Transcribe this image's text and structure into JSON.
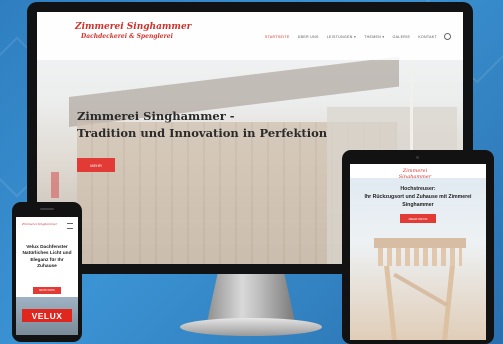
{
  "desktop": {
    "logo_line1": "Zimmerei Singhammer",
    "logo_line2": "Dachdeckerei & Spenglerei",
    "menu": [
      "STARTSEITE",
      "ÜBER UNS",
      "LEISTUNGEN ▾",
      "THEMEN ▾",
      "GALERIE",
      "KONTAKT"
    ],
    "hero_title_line1": "Zimmerei Singhammer -",
    "hero_title_line2": "Tradition und Innovation in Perfektion",
    "hero_button": "MEHR"
  },
  "tablet": {
    "logo": "Zimmerei Singhammer",
    "headline_line1": "Hochstreuser:",
    "headline_line2": "Ihr Rückzugsort und Zuhause mit Zimmerei",
    "headline_line3": "Singhammer",
    "button": "MEHR INFOS"
  },
  "phone": {
    "logo": "Zimmerei Singhammer",
    "headline": "Velux Dachfenster Natürliches Licht und Eleganz für Ihr Zuhause",
    "button": "MEHR INFOS",
    "banner": "VELUX"
  },
  "colors": {
    "background": "#2f7fc0",
    "accent": "#e23a35",
    "device_frame": "#121212"
  }
}
